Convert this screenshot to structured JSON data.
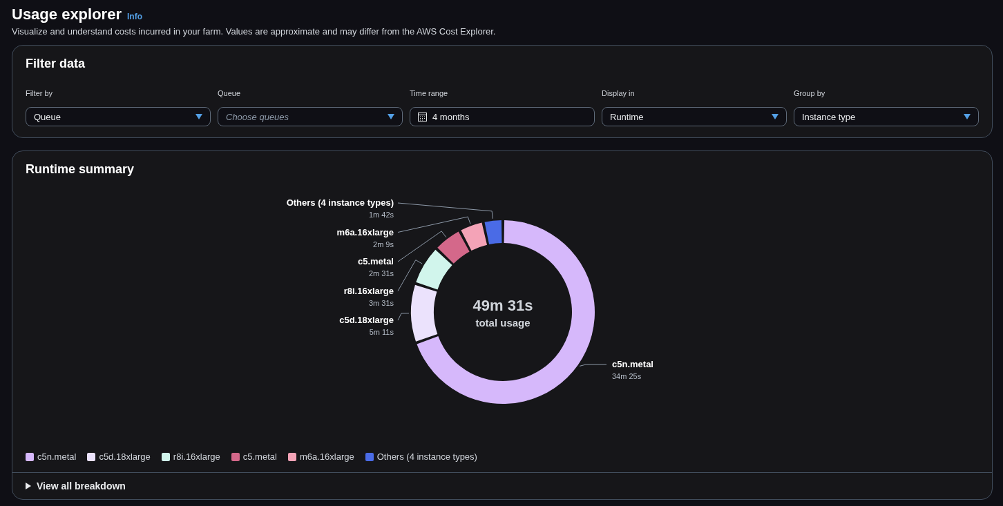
{
  "header": {
    "title": "Usage explorer",
    "info_link": "Info",
    "description": "Visualize and understand costs incurred in your farm. Values are approximate and may differ from the AWS Cost Explorer."
  },
  "filter_panel": {
    "title": "Filter data",
    "fields": [
      {
        "kind": "select",
        "label": "Filter by",
        "value": "Queue"
      },
      {
        "kind": "select",
        "label": "Queue",
        "placeholder": "Choose queues"
      },
      {
        "kind": "date",
        "label": "Time range",
        "value": "4 months"
      },
      {
        "kind": "select",
        "label": "Display in",
        "value": "Runtime"
      },
      {
        "kind": "select",
        "label": "Group by",
        "value": "Instance type"
      }
    ]
  },
  "summary_panel": {
    "title": "Runtime summary",
    "center_value": "49m 31s",
    "center_label": "total usage",
    "chart_data": {
      "type": "donut",
      "categories": [
        "c5n.metal",
        "c5d.18xlarge",
        "r8i.16xlarge",
        "c5.metal",
        "m6a.16xlarge",
        "Others (4 instance types)"
      ],
      "series": [
        {
          "values": [
            69.55,
            10.47,
            7.11,
            5.09,
            4.34,
            3.44
          ]
        }
      ],
      "colors": [
        "#d6b8fb",
        "#ebe2fc",
        "#d1f5ec",
        "#d4688a",
        "#f4a3b7",
        "#4a6be6"
      ],
      "value_labels": [
        "34m 25s",
        "5m 11s",
        "3m 31s",
        "2m 31s",
        "2m 9s",
        "1m 42s"
      ]
    },
    "breakdown": {
      "label": "View all breakdown",
      "expanded": false
    }
  }
}
